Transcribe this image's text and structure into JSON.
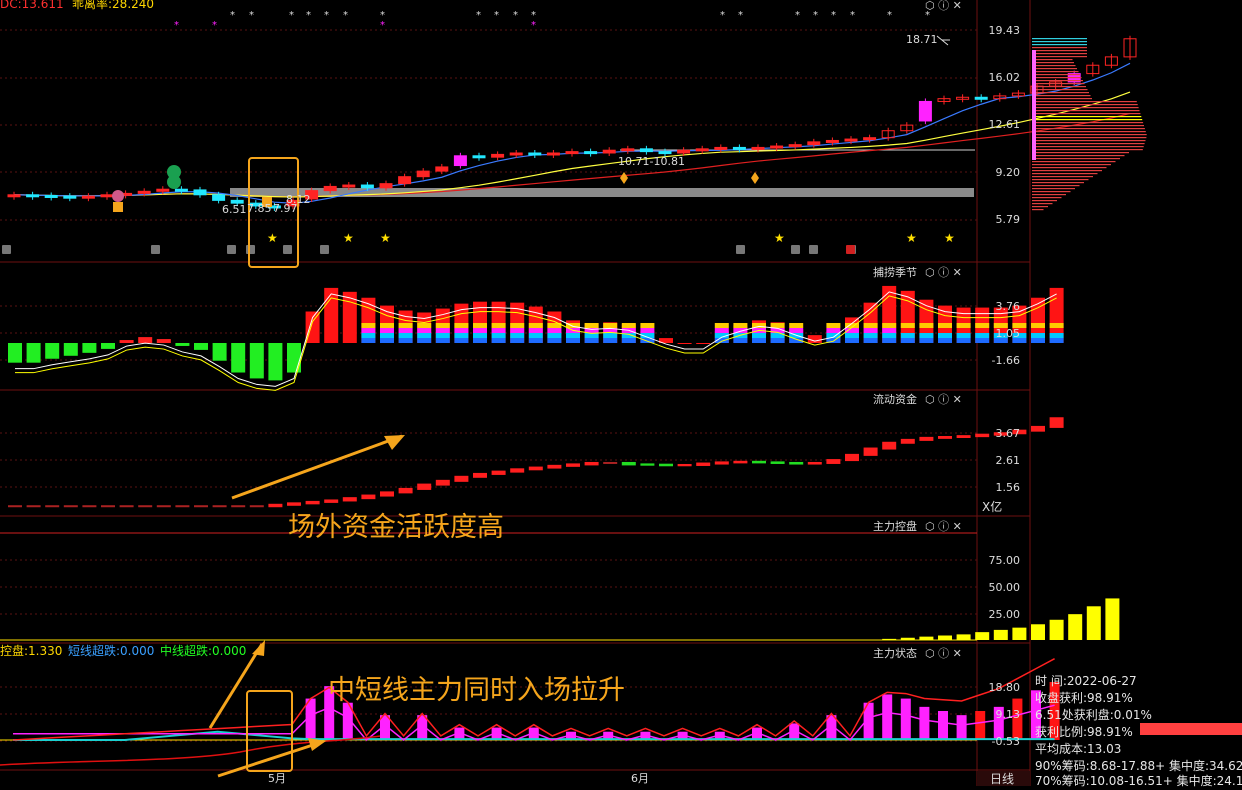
{
  "header": {
    "left_text1": "DC:13.611",
    "left_text2": "乖离率:28.240"
  },
  "panels": {
    "p1": {
      "ticks": [
        "19.43",
        "16.02",
        "12.61",
        "9.20",
        "5.79"
      ],
      "labels": {
        "high": "18.71",
        "b1": "10.71-10.81",
        "b2": "6.51",
        "b3": "7.85",
        "b4": "7.97",
        "b5": "8.12"
      }
    },
    "p2": {
      "title": "捕捞季节",
      "ticks": [
        "3.76",
        "1.05",
        "-1.66"
      ]
    },
    "p3": {
      "title": "流动资金",
      "ticks": [
        "3.67",
        "2.61",
        "1.56"
      ],
      "unit": "X亿"
    },
    "p4": {
      "title": "主力控盘",
      "ticks": [
        "75.00",
        "50.00",
        "25.00"
      ]
    },
    "p5": {
      "title": "主力状态",
      "ticks": [
        "18.80",
        "9.13",
        "-0.53"
      ],
      "legend": [
        "控盘:1.330",
        "短线超跌:0.000",
        "中线超跌:0.000"
      ]
    }
  },
  "annotations": {
    "a1": "场外资金活跃度高",
    "a2": "中短线主力同时入场拉升"
  },
  "xaxis": {
    "m5": "5月",
    "m6": "6月",
    "period": "日线"
  },
  "info": {
    "time": "时      间:2022-06-27",
    "rows": [
      "收盘获利:98.91%",
      "6.51处获利盘:0.01%",
      "获利比例:98.91%",
      "平均成本:13.03",
      "90%筹码:8.68-17.88+ 集中度:34.62",
      "70%筹码:10.08-16.51+ 集中度:24.19"
    ]
  },
  "colors": {
    "up": "#ff2424",
    "down": "#22e8ff",
    "magenta": "#ff22ff",
    "yellow": "#ffff00",
    "green": "#22ff22",
    "orange": "#f5a51c"
  },
  "chart_data": [
    {
      "type": "candlestick",
      "ylim": [
        5.0,
        20.0
      ],
      "ticks": [
        19.43,
        16.02,
        12.61,
        9.2,
        5.79
      ],
      "close": [
        7.6,
        7.55,
        7.5,
        7.45,
        7.5,
        7.6,
        7.7,
        7.85,
        8.0,
        7.95,
        7.6,
        7.2,
        7.0,
        6.8,
        6.75,
        7.2,
        7.9,
        8.2,
        8.3,
        8.1,
        8.4,
        8.9,
        9.3,
        9.6,
        10.4,
        10.3,
        10.5,
        10.6,
        10.5,
        10.6,
        10.7,
        10.6,
        10.8,
        10.9,
        10.7,
        10.6,
        10.8,
        10.9,
        11.0,
        10.9,
        11.0,
        11.1,
        11.2,
        11.4,
        11.5,
        11.6,
        11.7,
        12.2,
        12.6,
        14.3,
        14.5,
        14.6,
        14.5,
        14.7,
        14.9,
        15.4,
        15.7,
        16.3,
        16.9,
        17.5,
        18.8
      ],
      "open": [
        7.5,
        7.6,
        7.55,
        7.5,
        7.45,
        7.5,
        7.6,
        7.7,
        7.85,
        8.0,
        7.95,
        7.6,
        7.2,
        7.0,
        6.8,
        6.8,
        7.3,
        7.9,
        8.2,
        8.3,
        8.1,
        8.4,
        8.9,
        9.3,
        9.7,
        10.4,
        10.3,
        10.5,
        10.6,
        10.5,
        10.6,
        10.7,
        10.6,
        10.8,
        10.9,
        10.7,
        10.6,
        10.8,
        10.9,
        11.0,
        10.9,
        11.0,
        11.1,
        11.2,
        11.4,
        11.5,
        11.6,
        11.7,
        12.2,
        12.9,
        14.3,
        14.5,
        14.6,
        14.5,
        14.7,
        14.9,
        15.4,
        15.7,
        16.3,
        16.9,
        17.5
      ]
    },
    {
      "type": "bar",
      "ylim": [
        -3.5,
        6.5
      ],
      "ticks": [
        3.76,
        1.05,
        -1.66
      ],
      "values": [
        -2.0,
        -2.0,
        -1.6,
        -1.3,
        -1.0,
        -0.6,
        0.3,
        0.6,
        0.4,
        -0.3,
        -0.7,
        -1.8,
        -3.0,
        -3.6,
        -3.8,
        -3.0,
        3.2,
        5.6,
        5.2,
        4.6,
        3.8,
        3.3,
        3.1,
        3.5,
        4.0,
        4.2,
        4.2,
        4.1,
        3.7,
        3.2,
        2.3,
        2.0,
        2.1,
        1.9,
        1.2,
        0.5,
        0,
        0,
        1.2,
        1.8,
        2.3,
        2.1,
        1.4,
        0.8,
        1.2,
        2.6,
        4.1,
        5.8,
        5.3,
        4.4,
        3.8,
        3.6,
        3.6,
        3.6,
        3.8,
        4.6,
        5.6
      ]
    },
    {
      "type": "bar",
      "ylim": [
        0.9,
        4.5
      ],
      "ticks": [
        3.67,
        2.61,
        1.56
      ],
      "values": [
        1.1,
        1.1,
        1.1,
        1.1,
        1.1,
        1.1,
        1.1,
        1.1,
        1.1,
        1.1,
        1.1,
        1.1,
        1.1,
        1.1,
        1.15,
        1.2,
        1.25,
        1.3,
        1.38,
        1.47,
        1.58,
        1.7,
        1.85,
        1.98,
        2.12,
        2.22,
        2.3,
        2.38,
        2.44,
        2.5,
        2.55,
        2.6,
        2.6,
        2.55,
        2.54,
        2.52,
        2.53,
        2.58,
        2.62,
        2.64,
        2.62,
        2.6,
        2.58,
        2.6,
        2.7,
        2.88,
        3.1,
        3.3,
        3.4,
        3.47,
        3.5,
        3.53,
        3.58,
        3.63,
        3.72,
        3.85,
        4.15
      ]
    },
    {
      "type": "bar",
      "ylim": [
        0,
        100
      ],
      "ticks": [
        75,
        50,
        25
      ],
      "values": [
        0,
        0,
        0,
        0,
        0,
        0,
        0,
        0,
        0,
        0,
        0,
        0,
        0,
        0,
        0,
        0,
        0,
        0,
        0,
        0,
        0,
        0,
        0,
        0,
        0,
        0,
        0,
        0,
        0,
        0,
        0,
        0,
        0,
        0,
        0,
        0,
        0,
        0,
        0,
        0,
        0,
        0,
        0,
        0,
        0,
        0,
        0,
        1,
        2,
        3,
        4,
        5,
        7,
        9,
        11,
        14,
        18,
        23,
        30,
        37
      ]
    },
    {
      "type": "bar",
      "ylim": [
        -2.5,
        24.0
      ],
      "ticks": [
        18.8,
        9.13,
        -0.53
      ],
      "values": [
        0,
        0,
        0,
        0,
        0,
        0,
        0,
        0,
        0,
        0,
        0,
        0,
        0,
        0,
        0,
        0,
        10,
        13,
        9,
        0,
        6,
        0,
        6,
        0,
        3,
        0,
        3,
        0,
        3,
        0,
        2,
        0,
        2,
        0,
        2,
        0,
        2,
        0,
        2,
        0,
        3,
        0,
        4,
        0,
        6,
        0,
        9,
        11,
        10,
        8,
        7,
        6,
        7,
        8,
        10,
        12,
        14
      ]
    }
  ]
}
